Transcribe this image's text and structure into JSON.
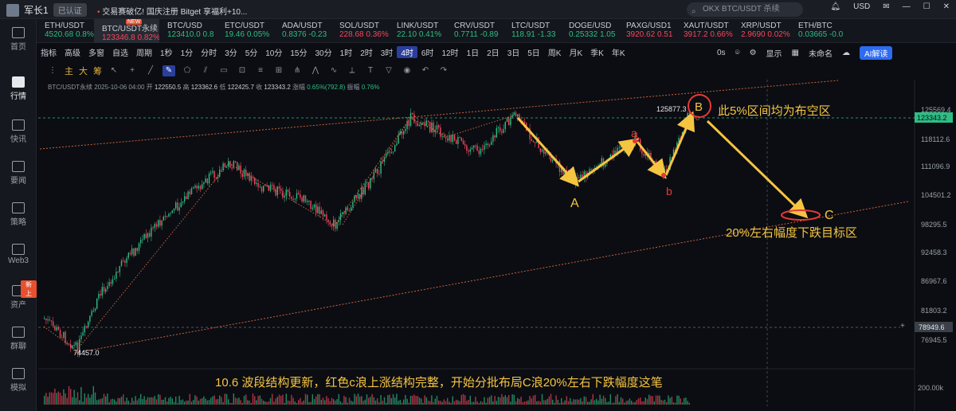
{
  "topbar": {
    "username": "军长1",
    "badge": "已认证",
    "news": "交易赛破亿!  国庆注册 Bitget 享福利+10...",
    "search_placeholder": "OKX BTC/USDT 杀续",
    "currency": "USD"
  },
  "sidebar": {
    "items": [
      {
        "label": "首页",
        "icon": "home-icon"
      },
      {
        "label": "行情",
        "icon": "chart-icon"
      },
      {
        "label": "快讯",
        "icon": "flash-news-icon"
      },
      {
        "label": "要闻",
        "icon": "news-icon"
      },
      {
        "label": "策略",
        "icon": "strategy-icon"
      },
      {
        "label": "Web3",
        "icon": "web3-icon"
      },
      {
        "label": "资产",
        "icon": "asset-icon"
      },
      {
        "label": "群聊",
        "icon": "chat-icon"
      },
      {
        "label": "模拟",
        "icon": "simulate-icon"
      }
    ],
    "new_tag": "新上"
  },
  "tickers": [
    {
      "name": "ETH/USDT",
      "price": "4520.68",
      "change": "0.8%",
      "dir": "up"
    },
    {
      "name": "BTC/USDT永续",
      "price": "123346.8",
      "change": "0.82%",
      "dir": "dn",
      "active": true
    },
    {
      "name": "BTC/USD",
      "price": "123410.0",
      "change": "0.8",
      "dir": "up"
    },
    {
      "name": "ETC/USDT",
      "price": "19.46",
      "change": "0.05%",
      "dir": "up"
    },
    {
      "name": "ADA/USDT",
      "price": "0.8376",
      "change": "-0.23",
      "dir": "up"
    },
    {
      "name": "SOL/USDT",
      "price": "228.68",
      "change": "0.36%",
      "dir": "dn"
    },
    {
      "name": "LINK/USDT",
      "price": "22.10",
      "change": "0.41%",
      "dir": "up"
    },
    {
      "name": "CRV/USDT",
      "price": "0.7711",
      "change": "-0.89",
      "dir": "up"
    },
    {
      "name": "LTC/USDT",
      "price": "118.91",
      "change": "-1.33",
      "dir": "up"
    },
    {
      "name": "DOGE/USD",
      "price": "0.25332",
      "change": "1.05",
      "dir": "up"
    },
    {
      "name": "PAXG/USD1",
      "price": "3920.62",
      "change": "0.51",
      "dir": "dn"
    },
    {
      "name": "XAUT/USDT",
      "price": "3917.2",
      "change": "0.66%",
      "dir": "dn"
    },
    {
      "name": "XRP/USDT",
      "price": "2.9690",
      "change": "0.02%",
      "dir": "dn"
    },
    {
      "name": "ETH/BTC",
      "price": "0.03665",
      "change": "-0.0",
      "dir": "up"
    }
  ],
  "toolbar": {
    "items": [
      "指标",
      "高级",
      "多窗",
      "自选",
      "周期",
      "1秒",
      "1分",
      "分时",
      "3分",
      "5分",
      "10分",
      "15分",
      "30分",
      "1时",
      "2时",
      "3时",
      "4时",
      "6时",
      "12时",
      "1日",
      "2日",
      "3日",
      "5日",
      "周K",
      "月K",
      "季K",
      "年K"
    ],
    "selected": "4时",
    "right": {
      "zero": "0s",
      "show": "显示",
      "unnamed": "未命名",
      "ai": "AI解读"
    }
  },
  "drawing_toolbar": {
    "cn_tools": [
      "主",
      "大",
      "筹"
    ]
  },
  "chart_info": {
    "symbol": "BTC/USDT永续",
    "datetime": "2025-10-06 04:00",
    "open": "122550.5",
    "high": "123362.6",
    "low": "122425.7",
    "close": "123343.2",
    "change": "0.65%(792.8)",
    "amplitude": "0.76%",
    "open_label": "开",
    "high_label": "高",
    "low_label": "低",
    "close_label": "收",
    "change_label": "涨幅",
    "amp_label": "振幅"
  },
  "price_axis": {
    "ticks": [
      "125569.4",
      "118112.6",
      "111096.9",
      "104501.2",
      "98295.5",
      "92458.3",
      "86967.6",
      "81803.2",
      "76945.5"
    ],
    "current_price": "123343.2",
    "crosshair_price": "78949.6",
    "volume_label": "200.00k"
  },
  "annotations": {
    "high_label": "125877.3",
    "low_label": "74457.0",
    "wave_A": "A",
    "wave_B": "B",
    "wave_C": "C",
    "wave_a": "a",
    "wave_b": "b",
    "wave_c": "c",
    "short_zone": "此5%区间均为布空区",
    "target_zone": "20%左右幅度下跌目标区",
    "caption": "10.6 波段结构更新，红色c浪上涨结构完整，开始分批布局C浪20%左右下跌幅度这笔"
  },
  "colors": {
    "up": "#2ebd85",
    "down": "#f6465d",
    "annotation_yellow": "#f5c542",
    "circle_red": "#e53935",
    "accent_blue": "#2d6bf0"
  }
}
